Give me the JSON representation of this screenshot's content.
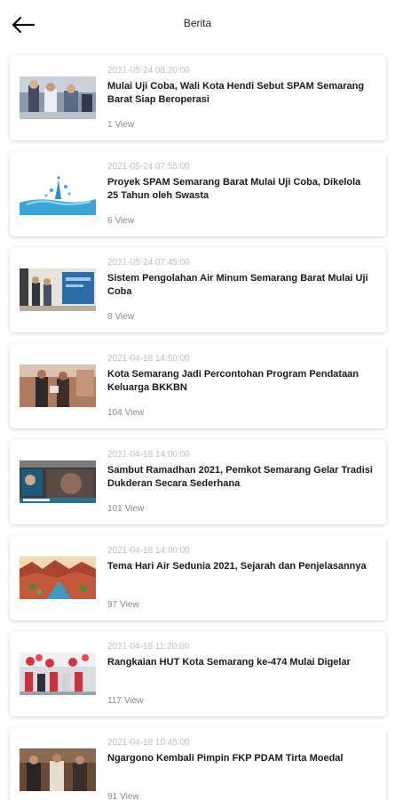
{
  "header": {
    "title": "Berita",
    "back_icon": "arrow-left-icon"
  },
  "news": [
    {
      "date": "2021-05-24 08:20:00",
      "title": "Mulai Uji Coba, Wali Kota Hendi Sebut SPAM Semarang Barat Siap Beroperasi",
      "views": "1",
      "view_label": "View",
      "thumbnail": "officials-inspection-photo"
    },
    {
      "date": "2021-05-24 07:55:00",
      "title": "Proyek SPAM Semarang Barat Mulai Uji Coba, Dikelola 25 Tahun oleh Swasta",
      "views": "6",
      "view_label": "View",
      "thumbnail": "water-splash-photo"
    },
    {
      "date": "2021-05-24 07:45:00",
      "title": "Sistem Pengolahan Air Minum Semarang Barat Mulai Uji Coba",
      "views": "8",
      "view_label": "View",
      "thumbnail": "water-facility-photo"
    },
    {
      "date": "2021-04-18 14:50:00",
      "title": "Kota Semarang Jadi Percontohan Program Pendataan Keluarga BKKBN",
      "views": "104",
      "view_label": "View",
      "thumbnail": "two-officials-photo"
    },
    {
      "date": "2021-04-18 14:00:00",
      "title": "Sambut Ramadhan 2021, Pemkot Semarang Gelar Tradisi Dukderan Secara Sederhana",
      "views": "101",
      "view_label": "View",
      "thumbnail": "broadcast-screen-photo"
    },
    {
      "date": "2021-04-18 14:00:00",
      "title": "Tema Hari Air Sedunia 2021, Sejarah dan Penjelasannya",
      "views": "97",
      "view_label": "View",
      "thumbnail": "river-landscape-illustration"
    },
    {
      "date": "2021-04-18 11:20:00",
      "title": "Rangkaian HUT Kota Semarang ke-474 Mulai Digelar",
      "views": "117",
      "view_label": "View",
      "thumbnail": "balloon-celebration-photo"
    },
    {
      "date": "2021-04-18 10:45:00",
      "title": "Ngargono Kembali Pimpin FKP PDAM Tirta Moedal",
      "views": "91",
      "view_label": "View",
      "thumbnail": "group-portrait-photo"
    }
  ]
}
